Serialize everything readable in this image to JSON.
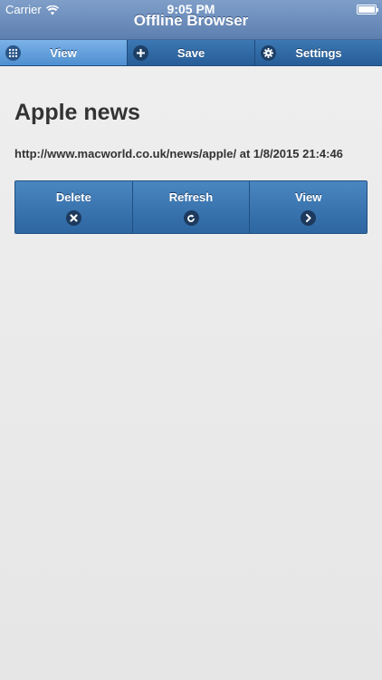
{
  "status_bar": {
    "carrier": "Carrier",
    "time": "9:05 PM"
  },
  "header": {
    "title": "Offline Browser"
  },
  "tabs": [
    {
      "label": "View",
      "icon": "grid-icon",
      "active": true
    },
    {
      "label": "Save",
      "icon": "plus-icon",
      "active": false
    },
    {
      "label": "Settings",
      "icon": "gear-icon",
      "active": false
    }
  ],
  "page": {
    "title": "Apple news",
    "url_line": "http://www.macworld.co.uk/news/apple/ at 1/8/2015 21:4:46"
  },
  "actions": [
    {
      "label": "Delete",
      "icon": "close-icon"
    },
    {
      "label": "Refresh",
      "icon": "refresh-icon"
    },
    {
      "label": "View",
      "icon": "chevron-right-icon"
    }
  ],
  "colors": {
    "header": "#6f90c0",
    "tabbar": "#3068a4",
    "tab_active": "#6aa4e0",
    "button": "#3a76b0",
    "text": "#333333"
  }
}
